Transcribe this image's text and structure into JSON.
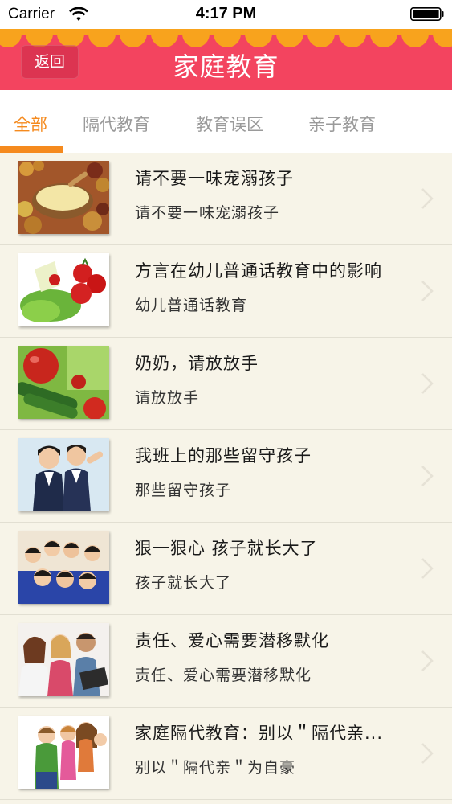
{
  "status_bar": {
    "carrier": "Carrier",
    "time": "4:17 PM"
  },
  "nav": {
    "back_label": "返回",
    "title": "家庭教育"
  },
  "tabs": [
    {
      "label": "全部",
      "active": true
    },
    {
      "label": "隔代教育",
      "active": false
    },
    {
      "label": "教育误区",
      "active": false
    },
    {
      "label": "亲子教育",
      "active": false
    }
  ],
  "colors": {
    "accent": "#f58a1e",
    "nav_bg": "#f3445f",
    "scallop": "#f8a31d",
    "background": "#f7f4e8"
  },
  "articles": [
    {
      "title": "请不要一味宠溺孩子",
      "subtitle": "请不要一味宠溺孩子",
      "thumb": "grains-bowl-image"
    },
    {
      "title": "方言在幼儿普通话教育中的影响",
      "subtitle": "幼儿普通话教育",
      "thumb": "vegetables-tomato-image"
    },
    {
      "title": "奶奶，请放放手",
      "subtitle": "请放放手",
      "thumb": "cucumber-tomato-image"
    },
    {
      "title": "我班上的那些留守孩子",
      "subtitle": "那些留守孩子",
      "thumb": "students-image"
    },
    {
      "title": "狠一狠心 孩子就长大了",
      "subtitle": "孩子就长大了",
      "thumb": "group-kids-image"
    },
    {
      "title": "责任、爱心需要潜移默化",
      "subtitle": "责任、爱心需要潜移默化",
      "thumb": "teens-laptop-image"
    },
    {
      "title": "家庭隔代教育：别以＂隔代亲...",
      "subtitle": "别以＂隔代亲＂为自豪",
      "thumb": "family-kids-image"
    }
  ]
}
